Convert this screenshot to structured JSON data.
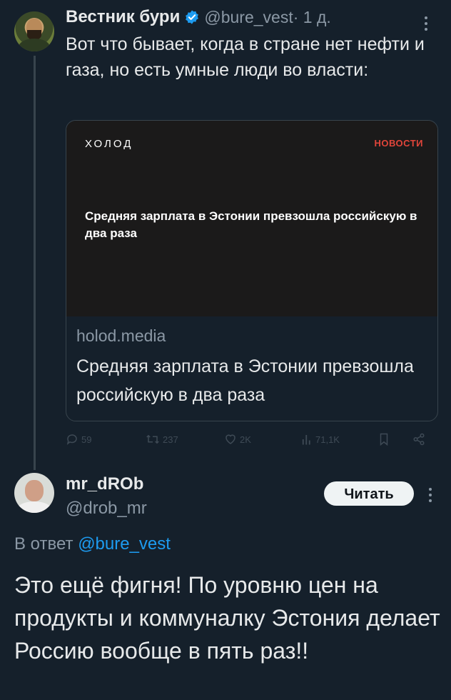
{
  "quoted_tweet": {
    "author_name": "Вестник бури",
    "handle": "@bure_vest",
    "time": "· 1 д.",
    "text": "Вот что бывает, когда в стране нет нефти и газа, но есть умные люди во власти:",
    "card": {
      "brand": "ХОЛОД",
      "section": "НОВОСТИ",
      "image_title": "Средняя зарплата в Эстонии превзошла российскую в два раза",
      "domain": "holod.media",
      "title": "Средняя зарплата в Эстонии превзошла российскую в два раза"
    },
    "actions": {
      "replies": "59",
      "retweets": "237",
      "likes": "2K",
      "views": "71,1K"
    },
    "colors": {
      "verified": "#1d9bf0"
    }
  },
  "reply_tweet": {
    "author_name": "mr_dROb",
    "handle": "@drob_mr",
    "follow_label": "Читать",
    "reply_prefix": "В ответ",
    "reply_mention": "@bure_vest",
    "text": "Это ещё фигня! По уровню цен на продукты и коммуналку Эстония делает Россию вообще в пять раз!!"
  },
  "theme": {
    "background": "#15202b",
    "text": "#e7e9ea",
    "secondary": "#8b98a5",
    "link": "#1d9bf0"
  }
}
